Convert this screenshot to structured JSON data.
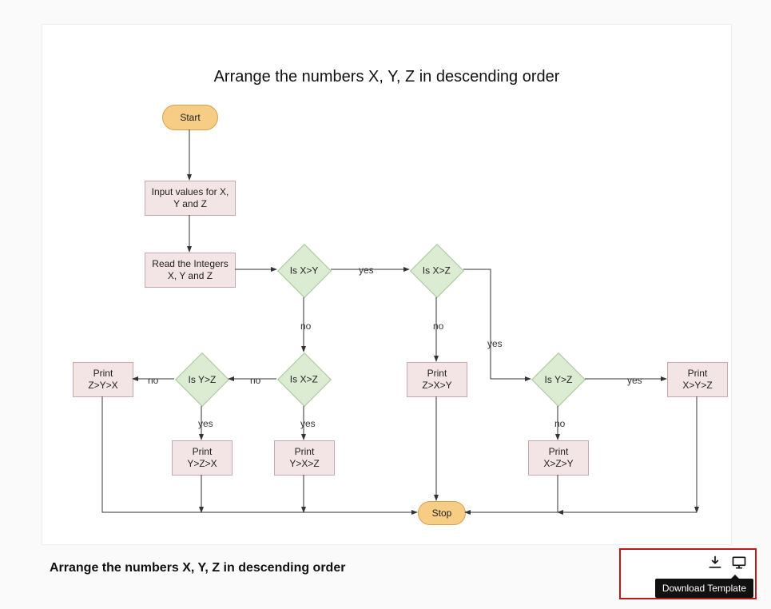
{
  "title": "Arrange the numbers X, Y, Z in descending order",
  "caption": "Arrange the numbers X, Y, Z in descending order",
  "tooltip": "Download Template",
  "nodes": {
    "start": "Start",
    "input": "Input values for X, Y and Z",
    "read": "Read the Integers X, Y and Z",
    "dec_x_y": "Is X>Y",
    "dec_x_z_top": "Is X>Z",
    "dec_x_z_mid": "Is X>Z",
    "dec_y_z_left": "Is Y>Z",
    "dec_y_z_right": "Is Y>Z",
    "print_zyx": "Print\nZ>Y>X",
    "print_zxy": "Print\nZ>X>Y",
    "print_yzx": "Print\nY>Z>X",
    "print_yxz": "Print\nY>X>Z",
    "print_xzy": "Print\nX>Z>Y",
    "print_xyz": "Print\nX>Y>Z",
    "stop": "Stop"
  },
  "labels": {
    "yes": "yes",
    "no": "no"
  }
}
